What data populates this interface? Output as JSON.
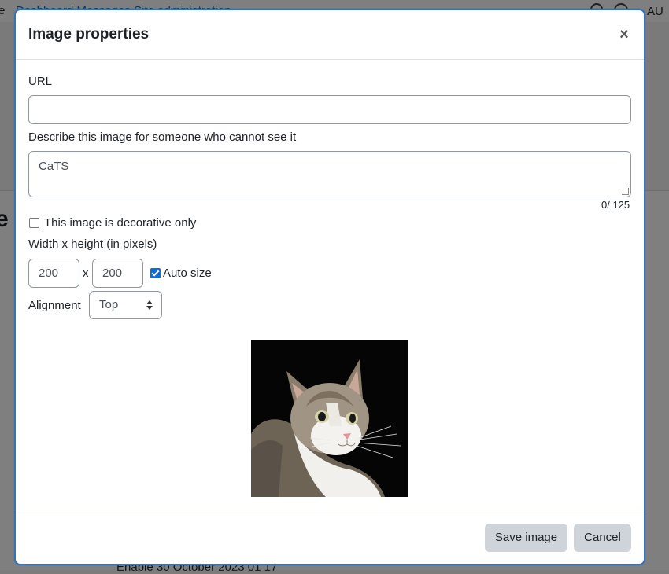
{
  "background": {
    "nav_edge": "e",
    "breadcrumb": "Dashboard  Messages  Site administration",
    "user_initials": "AU",
    "heading_edge": "e",
    "bottom_row": "Enable   30        October        2023      01     17"
  },
  "dialog": {
    "title": "Image properties",
    "close_glyph": "×",
    "url_label": "URL",
    "url_value": "",
    "alt_label": "Describe this image for someone who cannot see it",
    "alt_value": "CaTS",
    "char_counter": "0/ 125",
    "decorative_label": "This image is decorative only",
    "decorative_checked": false,
    "size_label": "Width x height (in pixels)",
    "width_value": "200",
    "size_separator": "x",
    "height_value": "200",
    "autosize_label": "Auto size",
    "autosize_checked": true,
    "alignment_label": "Alignment",
    "alignment_value": "Top",
    "preview_icon": "cat-image",
    "save_label": "Save image",
    "cancel_label": "Cancel"
  },
  "colors": {
    "accent": "#0f6cbf",
    "dialog_border": "#3574b8",
    "checkbox_checked": "#0b6fd6",
    "button_bg": "#ced4da"
  }
}
